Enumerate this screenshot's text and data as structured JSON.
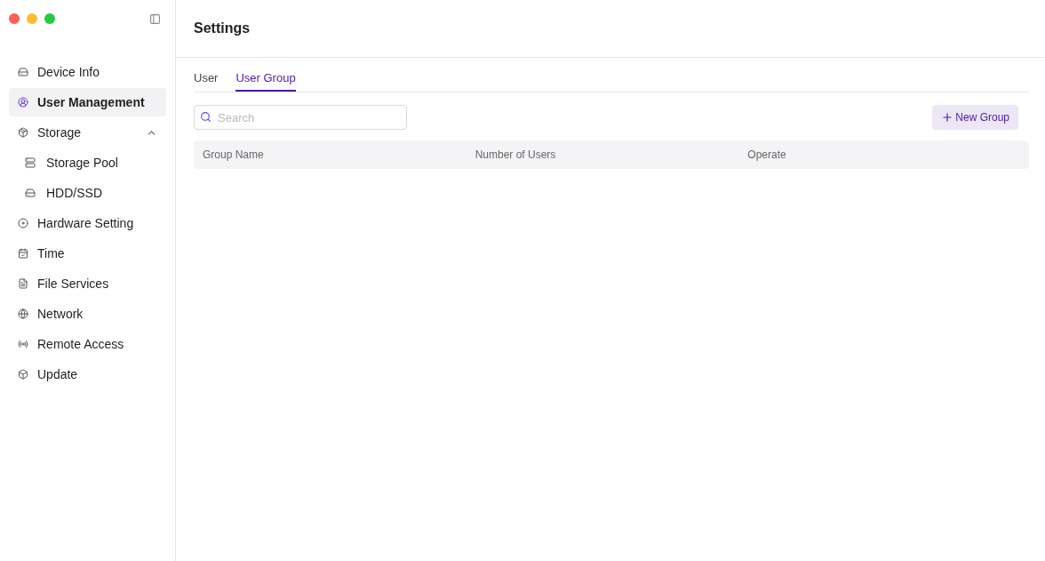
{
  "sidebar": {
    "items": [
      {
        "label": "Device Info",
        "selected": false
      },
      {
        "label": "User Management",
        "selected": true
      },
      {
        "label": "Storage",
        "selected": false,
        "expanded": true,
        "children": [
          {
            "label": "Storage Pool",
            "selected": false
          },
          {
            "label": "HDD/SSD",
            "selected": false
          }
        ]
      },
      {
        "label": "Hardware Setting",
        "selected": false
      },
      {
        "label": "Time",
        "selected": false
      },
      {
        "label": "File Services",
        "selected": false
      },
      {
        "label": "Network",
        "selected": false
      },
      {
        "label": "Remote Access",
        "selected": false
      },
      {
        "label": "Update",
        "selected": false
      }
    ]
  },
  "page": {
    "title": "Settings"
  },
  "tabs": [
    {
      "label": "User",
      "selected": false
    },
    {
      "label": "User Group",
      "selected": true
    }
  ],
  "search": {
    "placeholder": "Search"
  },
  "new_button": {
    "label": "New Group"
  },
  "table": {
    "columns": [
      "Group Name",
      "Number of Users",
      "Operate"
    ]
  }
}
